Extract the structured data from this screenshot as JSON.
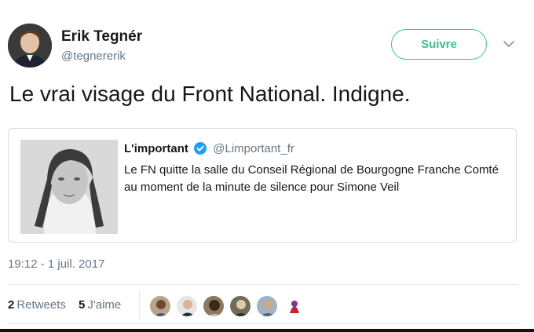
{
  "tweet": {
    "author_name": "Erik Tegnér",
    "author_handle": "@tegnererik",
    "follow_label": "Suivre",
    "text": "Le vrai visage du Front National. Indigne.",
    "timestamp": "19:12 - 1 juil. 2017",
    "retweets_count": "2",
    "retweets_label": "Retweets",
    "likes_count": "5",
    "likes_label": "J'aime"
  },
  "quoted": {
    "name": "L'important",
    "handle": "@Limportant_fr",
    "text": "Le FN quitte la salle du Conseil Régional de Bourgogne Franche Comté au moment de la minute de silence pour Simone Veil"
  },
  "colors": {
    "follow_accent": "#3bbf8c",
    "verified": "#1da1f2",
    "muted_text": "#657786"
  },
  "icons": {
    "chevron": "chevron-down-icon",
    "verified": "verified-badge-icon"
  }
}
